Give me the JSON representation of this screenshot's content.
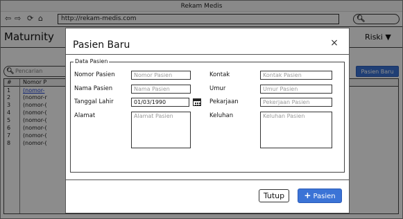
{
  "browser": {
    "title": "Rekam Medis",
    "url": "http://rekam-medis.com",
    "nav_icons": [
      "back-arrow-icon",
      "forward-arrow-icon",
      "reload-icon",
      "home-icon"
    ]
  },
  "app": {
    "title": "Maturnity",
    "user_menu": "Riski ▼"
  },
  "background": {
    "search_placeholder": "Pencarian",
    "add_button": "Pasien Baru",
    "table": {
      "columns": [
        "#",
        "Nomor P"
      ],
      "rows": [
        {
          "idx": "1",
          "nomor": "(nomor-"
        },
        {
          "idx": "2",
          "nomor": "(nomor-r"
        },
        {
          "idx": "3",
          "nomor": "(nomor-("
        },
        {
          "idx": "4",
          "nomor": "(nomor-("
        },
        {
          "idx": "5",
          "nomor": "(nomor-("
        },
        {
          "idx": "6",
          "nomor": "(nomor-("
        },
        {
          "idx": "7",
          "nomor": "(nomor-("
        },
        {
          "idx": "8",
          "nomor": "(nomor-("
        }
      ]
    }
  },
  "modal": {
    "title": "Pasien Baru",
    "close_symbol": "×",
    "legend": "Data Pasien",
    "fields": {
      "nomor_pasien": {
        "label": "Nomor Pasien",
        "placeholder": "Nomor Pasien"
      },
      "nama_pasien": {
        "label": "Nama Pasien",
        "placeholder": "Nama Pasien"
      },
      "tanggal_lahir": {
        "label": "Tanggal Lahir",
        "value": "01/03/1990"
      },
      "alamat": {
        "label": "Alamat",
        "placeholder": "Alamat Pasien"
      },
      "kontak": {
        "label": "Kontak",
        "placeholder": "Kontak Pasien"
      },
      "umur": {
        "label": "Umur",
        "placeholder": "Umur Pasien"
      },
      "pekerjaan": {
        "label": "Pekarjaan",
        "placeholder": "Pekerjaan Pasien"
      },
      "keluhan": {
        "label": "Keluhan",
        "placeholder": "Keluhan Pasien"
      }
    },
    "buttons": {
      "close": "Tutup",
      "add_plus": "+",
      "add": "Pasien"
    }
  },
  "colors": {
    "accent": "#3b73d6",
    "overlay": "rgba(0,0,0,0.45)"
  }
}
